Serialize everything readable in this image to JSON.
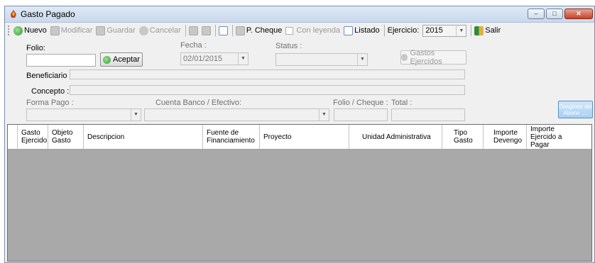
{
  "window": {
    "title": "Gasto Pagado",
    "minimize_glyph": "–",
    "maximize_glyph": "□",
    "close_glyph": "✕"
  },
  "toolbar": {
    "nuevo": "Nuevo",
    "modificar": "Modificar",
    "guardar": "Guardar",
    "cancelar": "Cancelar",
    "p_cheque": "P. Cheque",
    "con_leyenda": "Con leyenda",
    "listado": "Listado",
    "ejercicio_label": "Ejercicio:",
    "ejercicio_value": "2015",
    "salir": "Salir"
  },
  "form": {
    "folio_label": "Folio:",
    "folio_value": "",
    "aceptar": "Aceptar",
    "fecha_label": "Fecha :",
    "fecha_value": "02/01/2015",
    "status_label": "Status :",
    "status_value": "",
    "gastos_ejercidos": "Gastos Ejercidos",
    "beneficiario_label": "Beneficiario :",
    "beneficiario_value": "",
    "concepto_label": "Concepto :",
    "concepto_value": "",
    "forma_pago_label": "Forma Pago :",
    "forma_pago_value": "",
    "cuenta_label": "Cuenta Banco / Efectivo:",
    "cuenta_value": "",
    "folio_cheque_label": "Folio / Cheque :",
    "folio_cheque_value": "",
    "total_label": "Total :",
    "total_value": "",
    "desglose_line1": "Desglose del",
    "desglose_line2": "Abono ...."
  },
  "grid": {
    "columns": [
      "Gasto Ejercido",
      "Objeto Gasto",
      "Descripcion",
      "Fuente de Financiamiento",
      "Proyecto",
      "Unidad Administrativa",
      "Tipo Gasto",
      "Importe Devengo",
      "Importe Ejercido a Pagar"
    ],
    "rows": []
  },
  "colors": {
    "grid_background": "#a9a9a9",
    "window_background": "#f0f0f0",
    "titlebar": "#c9d9ec"
  }
}
